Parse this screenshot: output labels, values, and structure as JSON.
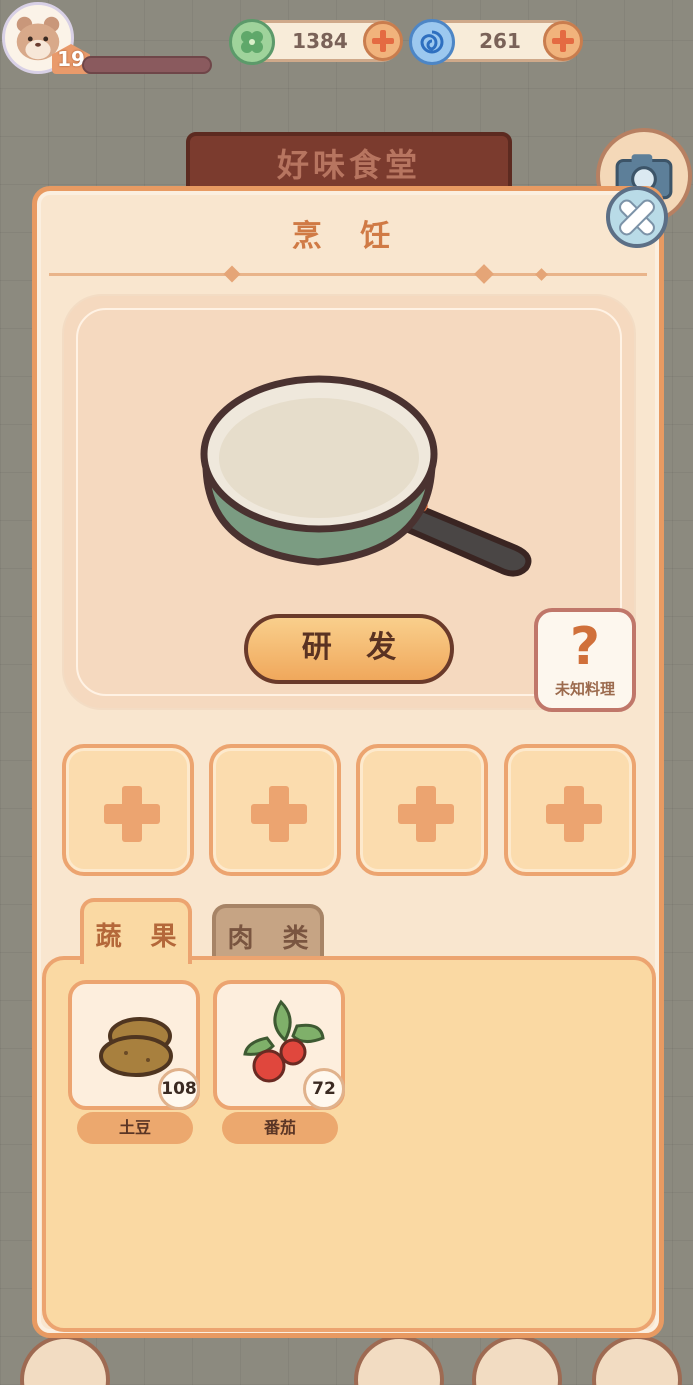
{
  "hud": {
    "level": "19",
    "clover": {
      "value": "1384",
      "icon": "clover-icon"
    },
    "gem": {
      "value": "261",
      "icon": "swirl-gem-icon"
    }
  },
  "background": {
    "sign_text": "好味食堂"
  },
  "cooking_panel": {
    "title": "烹 饪",
    "develop_button": "研 发",
    "unknown_recipe_mark": "?",
    "unknown_recipe_label": "未知料理",
    "ingredient_slots": 4
  },
  "tabs": [
    {
      "label": "蔬 果",
      "active": true
    },
    {
      "label": "肉 类",
      "active": false
    }
  ],
  "items": [
    {
      "name": "土豆",
      "count": "108",
      "icon": "potato-icon"
    },
    {
      "name": "番茄",
      "count": "72",
      "icon": "tomato-icon"
    }
  ],
  "colors": {
    "accent_orange": "#eca470",
    "panel_bg": "#f9e6cf",
    "title_text": "#d07a45",
    "close_button": "#b9dbe7"
  }
}
